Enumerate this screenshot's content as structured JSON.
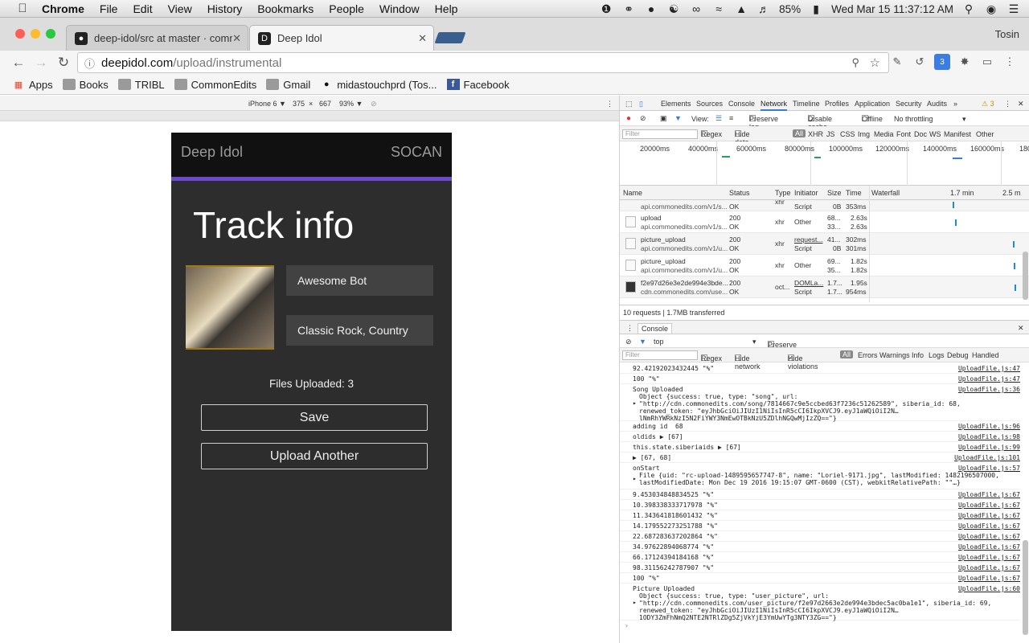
{
  "menubar": {
    "app": "Chrome",
    "items": [
      "File",
      "Edit",
      "View",
      "History",
      "Bookmarks",
      "People",
      "Window",
      "Help"
    ],
    "battery": "85%",
    "datetime": "Wed Mar 15  11:37:12 AM"
  },
  "tabs": [
    {
      "title": "deep-idol/src at master · comm",
      "active": false
    },
    {
      "title": "Deep Idol",
      "active": true
    }
  ],
  "profile": "Tosin",
  "address": {
    "host": "deepidol.com",
    "path": "/upload/instrumental"
  },
  "bookmarks": [
    "Apps",
    "Books",
    "TRIBL",
    "CommonEdits",
    "Gmail",
    "midastouchprd (Tos...",
    "Facebook"
  ],
  "device": {
    "name": "iPhone 6 ▼",
    "width": "375",
    "x": "×",
    "height": "667",
    "zoom": "93% ▼"
  },
  "app": {
    "brand": "Deep Idol",
    "partner": "SOCAN",
    "title": "Track info",
    "track_name": "Awesome Bot",
    "genres": "Classic Rock, Country",
    "files_uploaded": "Files Uploaded: 3",
    "save_label": "Save",
    "upload_another_label": "Upload Another"
  },
  "devtools": {
    "tabs": [
      "Elements",
      "Sources",
      "Console",
      "Network",
      "Timeline",
      "Profiles",
      "Application",
      "Security",
      "Audits",
      "»"
    ],
    "warnings": "⚠ 3",
    "net_toolbar": {
      "view": "View:",
      "preserve_log": "Preserve log",
      "disable_cache": "Disable cache",
      "offline": "Offline",
      "throttling": "No throttling"
    },
    "net_filter": {
      "placeholder": "Filter",
      "regex": "Regex",
      "hide_data": "Hide data URLs",
      "types": [
        "All",
        "XHR",
        "JS",
        "CSS",
        "Img",
        "Media",
        "Font",
        "Doc",
        "WS",
        "Manifest",
        "Other"
      ]
    },
    "timeline_ticks": [
      "20000ms",
      "40000ms",
      "60000ms",
      "80000ms",
      "100000ms",
      "120000ms",
      "140000ms",
      "160000ms",
      "180"
    ],
    "net_headers": [
      "Name",
      "Status",
      "Type",
      "Initiator",
      "Size",
      "Time",
      "Waterfall",
      "1.7 min",
      "2.5 m"
    ],
    "requests": [
      {
        "name": "upload",
        "url": "api.commonedits.com/v1/s...",
        "status": "200",
        "status2": "OK",
        "type": "xhr",
        "initiator": "Other",
        "size": "68...",
        "size2": "33...",
        "time": "2.63s",
        "time2": "2.63s"
      },
      {
        "name": "picture_upload",
        "url": "api.commonedits.com/v1/u...",
        "status": "200",
        "status2": "OK",
        "type": "xhr",
        "initiator": "request...",
        "initiator2": "Script",
        "size": "41...",
        "size2": "0B",
        "time": "302ms",
        "time2": "301ms"
      },
      {
        "name": "picture_upload",
        "url": "api.commonedits.com/v1/u...",
        "status": "200",
        "status2": "OK",
        "type": "xhr",
        "initiator": "Other",
        "size": "69...",
        "size2": "35...",
        "time": "1.82s",
        "time2": "1.82s"
      },
      {
        "name": "f2e97d26e3e2de994e3bde...",
        "url": "cdn.commonedits.com/use...",
        "status": "200",
        "status2": "OK",
        "type": "oct...",
        "initiator": "DOMLa...",
        "initiator2": "Script",
        "size": "1.7...",
        "size2": "1.7...",
        "time": "1.95s",
        "time2": "954ms"
      }
    ],
    "partial_row": {
      "url": "api.commonedits.com/v1/s...",
      "status": "OK",
      "type": "xhr",
      "initiator": "Script",
      "size": "0B",
      "time": "353ms"
    },
    "net_status": "10 requests | 1.7MB transferred",
    "console_tab": "Console",
    "context": "top",
    "preserve_log": "Preserve log",
    "console_filter": {
      "placeholder": "Filter",
      "regex": "Regex",
      "hide_network": "Hide network",
      "hide_violations": "Hide violations",
      "levels": [
        "All",
        "Errors",
        "Warnings",
        "Info",
        "Logs",
        "Debug",
        "Handled"
      ]
    },
    "console_lines": [
      {
        "text": "92.42192023432445 \"%\"",
        "src": "UploadFile.js:47"
      },
      {
        "text": "100 \"%\"",
        "src": "UploadFile.js:47"
      },
      {
        "text": "Song Uploaded",
        "src": "UploadFile.js:36"
      },
      {
        "text": "adding id  68",
        "src": "UploadFile.js:96"
      },
      {
        "text": "oldids ▶ [67]",
        "src": "UploadFile.js:98"
      },
      {
        "text": "this.state.siberiaids ▶ [67]",
        "src": "UploadFile.js:99"
      },
      {
        "text": "▶ [67, 68]",
        "src": "UploadFile.js:101"
      },
      {
        "text": "onStart",
        "src": "UploadFile.js:57"
      },
      {
        "text": "9.453034848834525 \"%\"",
        "src": "UploadFile.js:67"
      },
      {
        "text": "10.398338333717978 \"%\"",
        "src": "UploadFile.js:67"
      },
      {
        "text": "11.343641818601432 \"%\"",
        "src": "UploadFile.js:67"
      },
      {
        "text": "14.179552273251788 \"%\"",
        "src": "UploadFile.js:67"
      },
      {
        "text": "22.687283637202864 \"%\"",
        "src": "UploadFile.js:67"
      },
      {
        "text": "34.97622894068774 \"%\"",
        "src": "UploadFile.js:67"
      },
      {
        "text": "66.17124394184168 \"%\"",
        "src": "UploadFile.js:67"
      },
      {
        "text": "98.31156242787907 \"%\"",
        "src": "UploadFile.js:67"
      },
      {
        "text": "100 \"%\"",
        "src": "UploadFile.js:67"
      },
      {
        "text": "Picture Uploaded",
        "src": "UploadFile.js:60"
      }
    ],
    "song_obj": {
      "l1": "Object {success: true, type: \"song\", url:",
      "l2": "\"http://cdn.commonedits.com/song/7814667c9e5ccbed63f7236c51262589\", siberia_id: 68,",
      "l3": "renewed_token: \"eyJhbGciOiJIUzI1NiIsInR5cCI6IkpXVCJ9.eyJ1aWQiOiI2N…",
      "l4": "lNmRhYWRkNzI5N2FiYWY3NmEwOTBkNzU5ZDlhNGQwMjIzZQ==\"}"
    },
    "file_obj": {
      "l1": "File {uid: \"rc-upload-1489595657747-8\", name: \"Loriel-9171.jpg\", lastModified: 1482196507000,",
      "l2": "lastModifiedDate: Mon Dec 19 2016 19:15:07 GMT-0600 (CST), webkitRelativePath: \"\"…}"
    },
    "pic_obj": {
      "l1": "Object {success: true, type: \"user_picture\", url:",
      "l2": "\"http://cdn.commonedits.com/user_picture/f2e97d2663e2de994e3bdec5ac0ba1e1\", siberia_id: 69,",
      "l3": "renewed_token: \"eyJhbGciOiJIUzI1NiIsInR5cCI6IkpXVCJ9.eyJ1aWQiOiI2N…",
      "l4": "1ODY3ZmFhNmQ2NTE2NTRlZDg5ZjVkYjE3YmUwYTg3NTY3ZG==\"}"
    }
  }
}
